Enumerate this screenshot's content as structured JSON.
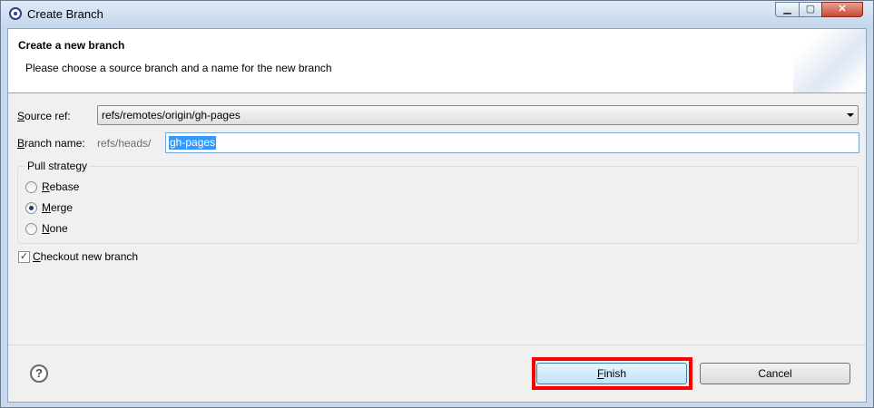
{
  "window": {
    "title": "Create Branch"
  },
  "header": {
    "title": "Create a new branch",
    "description": "Please choose a source branch and a name for the new branch"
  },
  "form": {
    "source_ref_label_accel": "S",
    "source_ref_label_rest": "ource ref:",
    "source_ref_value": "refs/remotes/origin/gh-pages",
    "branch_name_label_accel": "B",
    "branch_name_label_rest": "ranch name:",
    "branch_prefix": "refs/heads/",
    "branch_name_value": "gh-pages"
  },
  "pull_strategy": {
    "title": "Pull strategy",
    "options": [
      {
        "accel": "R",
        "rest": "ebase",
        "selected": false
      },
      {
        "accel": "M",
        "rest": "erge",
        "selected": true
      },
      {
        "accel": "N",
        "rest": "one",
        "selected": false
      }
    ]
  },
  "checkout": {
    "accel": "C",
    "rest": "heckout new branch",
    "checked": true
  },
  "buttons": {
    "finish_accel": "F",
    "finish_rest": "inish",
    "cancel": "Cancel",
    "help": "?"
  },
  "colors": {
    "highlight": "#ff0000",
    "selection": "#3399ff"
  }
}
